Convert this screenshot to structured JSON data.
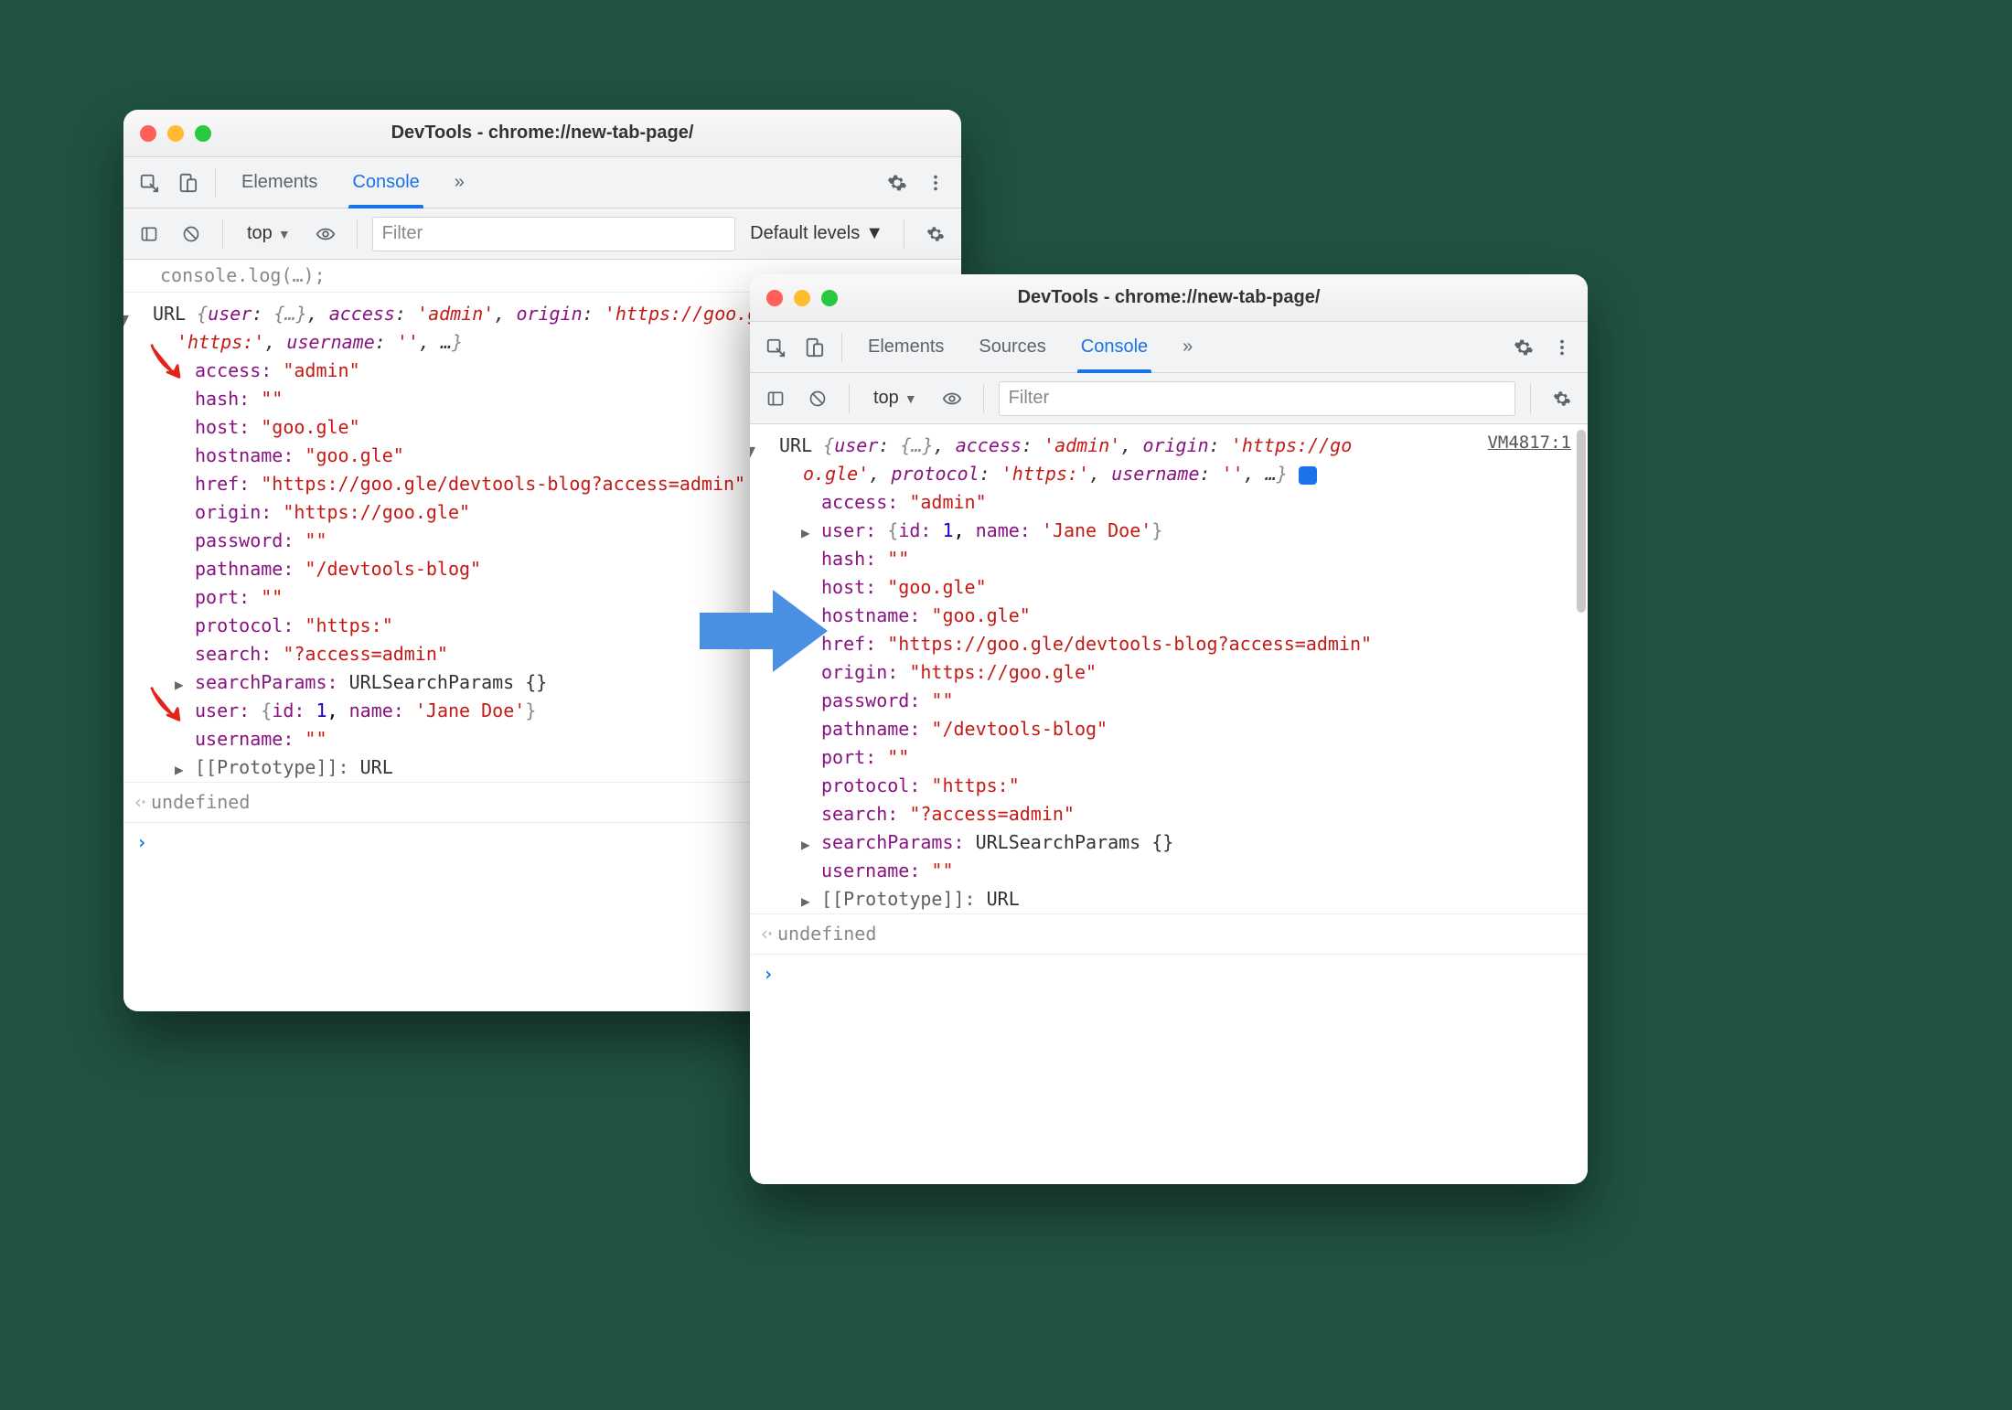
{
  "windowA": {
    "title": "DevTools - chrome://new-tab-page/",
    "tabs": {
      "elements": "Elements",
      "console": "Console",
      "more": "»"
    },
    "filter": {
      "context": "top",
      "placeholder": "Filter",
      "levels": "Default levels"
    },
    "cutoff": "console.log(…);",
    "summary": "URL {user: {…}, access: 'admin', origin: 'https://goo.gle', protocol: 'https:', username: '', …}",
    "props": {
      "access_k": "access:",
      "access_v": "\"admin\"",
      "hash_k": "hash:",
      "hash_v": "\"\"",
      "host_k": "host:",
      "host_v": "\"goo.gle\"",
      "hostname_k": "hostname:",
      "hostname_v": "\"goo.gle\"",
      "href_k": "href:",
      "href_v": "\"https://goo.gle/devtools-blog?access=admin\"",
      "origin_k": "origin:",
      "origin_v": "\"https://goo.gle\"",
      "password_k": "password:",
      "password_v": "\"\"",
      "pathname_k": "pathname:",
      "pathname_v": "\"/devtools-blog\"",
      "port_k": "port:",
      "port_v": "\"\"",
      "protocol_k": "protocol:",
      "protocol_v": "\"https:\"",
      "search_k": "search:",
      "search_v": "\"?access=admin\"",
      "searchParams_k": "searchParams:",
      "searchParams_v": "URLSearchParams {}",
      "user_k": "user:",
      "user_open": "{",
      "user_id_k": "id:",
      "user_id_v": "1",
      "user_name_k": "name:",
      "user_name_v": "'Jane Doe'",
      "user_close": "}",
      "username_k": "username:",
      "username_v": "\"\"",
      "proto_k": "[[Prototype]]:",
      "proto_v": "URL"
    },
    "undefined": "undefined",
    "prompt": "›"
  },
  "windowB": {
    "title": "DevTools - chrome://new-tab-page/",
    "tabs": {
      "elements": "Elements",
      "sources": "Sources",
      "console": "Console",
      "more": "»"
    },
    "filter": {
      "context": "top",
      "placeholder": "Filter"
    },
    "sourceLink": "VM4817:1",
    "summary": "URL {user: {…}, access: 'admin', origin: 'https://go\no.gle', protocol: 'https:', username: '', …}",
    "props": {
      "access_k": "access:",
      "access_v": "\"admin\"",
      "user_k": "user:",
      "user_open": "{",
      "user_id_k": "id:",
      "user_id_v": "1",
      "user_name_k": "name:",
      "user_name_v": "'Jane Doe'",
      "user_close": "}",
      "hash_k": "hash:",
      "hash_v": "\"\"",
      "host_k": "host:",
      "host_v": "\"goo.gle\"",
      "hostname_k": "hostname:",
      "hostname_v": "\"goo.gle\"",
      "href_k": "href:",
      "href_v": "\"https://goo.gle/devtools-blog?access=admin\"",
      "origin_k": "origin:",
      "origin_v": "\"https://goo.gle\"",
      "password_k": "password:",
      "password_v": "\"\"",
      "pathname_k": "pathname:",
      "pathname_v": "\"/devtools-blog\"",
      "port_k": "port:",
      "port_v": "\"\"",
      "protocol_k": "protocol:",
      "protocol_v": "\"https:\"",
      "search_k": "search:",
      "search_v": "\"?access=admin\"",
      "searchParams_k": "searchParams:",
      "searchParams_v": "URLSearchParams {}",
      "username_k": "username:",
      "username_v": "\"\"",
      "proto_k": "[[Prototype]]:",
      "proto_v": "URL"
    },
    "undefined": "undefined",
    "prompt": "›"
  },
  "info_badge": "i"
}
